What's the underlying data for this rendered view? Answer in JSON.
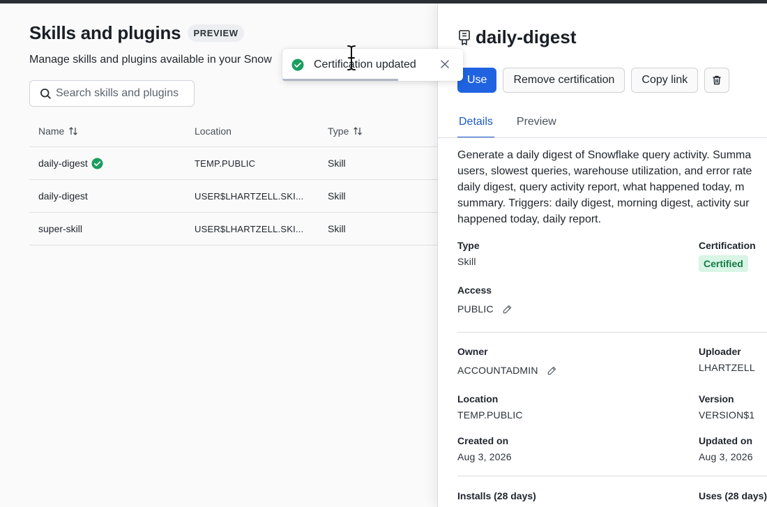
{
  "page": {
    "title": "Skills and plugins",
    "badge": "PREVIEW",
    "subtitle": "Manage skills and plugins available in your Snow",
    "search_placeholder": "Search skills and plugins"
  },
  "table": {
    "headers": {
      "name": "Name",
      "location": "Location",
      "type": "Type"
    },
    "rows": [
      {
        "name": "daily-digest",
        "location": "TEMP.PUBLIC",
        "type": "Skill",
        "certified": true
      },
      {
        "name": "daily-digest",
        "location": "USER$LHARTZELL.SKI...",
        "type": "Skill",
        "certified": false
      },
      {
        "name": "super-skill",
        "location": "USER$LHARTZELL.SKI...",
        "type": "Skill",
        "certified": false
      }
    ]
  },
  "toast": {
    "message": "Certification updated",
    "progress_fraction": 0.64
  },
  "panel": {
    "title": "daily-digest",
    "actions": {
      "use": "Use",
      "remove_certification": "Remove certification",
      "copy_link": "Copy link"
    },
    "tabs": [
      {
        "label": "Details",
        "active": true
      },
      {
        "label": "Preview",
        "active": false
      }
    ],
    "description_lines": [
      "Generate a daily digest of Snowflake query activity. Summa",
      "users, slowest queries, warehouse utilization, and error rate",
      "daily digest, query activity report, what happened today, m",
      "summary. Triggers: daily digest, morning digest, activity sur",
      "happened today, daily report."
    ],
    "meta": {
      "type_label": "Type",
      "type_value": "Skill",
      "certification_label": "Certification",
      "certification_value": "Certified",
      "access_label": "Access",
      "access_value": "PUBLIC",
      "owner_label": "Owner",
      "owner_value": "ACCOUNTADMIN",
      "uploader_label": "Uploader",
      "uploader_value": "LHARTZELL",
      "location_label": "Location",
      "location_value": "TEMP.PUBLIC",
      "version_label": "Version",
      "version_value": "VERSION$1",
      "created_label": "Created on",
      "created_value": "Aug 3, 2026",
      "updated_label": "Updated on",
      "updated_value": "Aug 3, 2026",
      "installs_label": "Installs (28 days)",
      "uses_label": "Uses (28 days)"
    }
  },
  "colors": {
    "primary": "#1f63e0",
    "success": "#1a9e5f",
    "certified_bg": "#d8f5e6",
    "certified_text": "#137a43",
    "tab_active": "#1c59c8"
  }
}
